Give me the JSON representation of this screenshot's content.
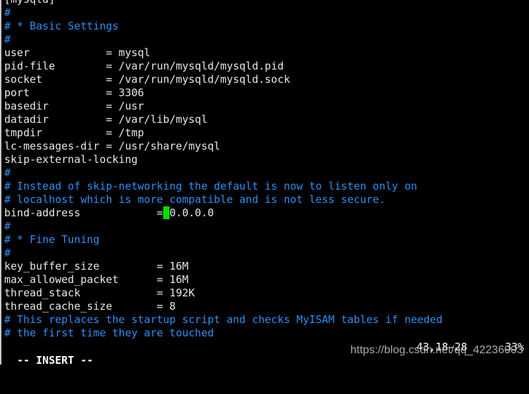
{
  "editor": {
    "lines": [
      {
        "text": "[mysqld]",
        "type": "code"
      },
      {
        "text": "#",
        "type": "comment"
      },
      {
        "text": "# * Basic Settings",
        "type": "comment"
      },
      {
        "text": "#",
        "type": "comment"
      },
      {
        "text": "user            = mysql",
        "type": "code"
      },
      {
        "text": "pid-file        = /var/run/mysqld/mysqld.pid",
        "type": "code"
      },
      {
        "text": "socket          = /var/run/mysqld/mysqld.sock",
        "type": "code"
      },
      {
        "text": "port            = 3306",
        "type": "code"
      },
      {
        "text": "basedir         = /usr",
        "type": "code"
      },
      {
        "text": "datadir         = /var/lib/mysql",
        "type": "code"
      },
      {
        "text": "tmpdir          = /tmp",
        "type": "code"
      },
      {
        "text": "lc-messages-dir = /usr/share/mysql",
        "type": "code"
      },
      {
        "text": "skip-external-locking",
        "type": "code"
      },
      {
        "text": "#",
        "type": "comment"
      },
      {
        "text": "# Instead of skip-networking the default is now to listen only on",
        "type": "comment"
      },
      {
        "text": "# localhost which is more compatible and is not less secure.",
        "type": "comment"
      },
      {
        "text": "bind-address            = 0.0.0.0",
        "type": "code",
        "cursor_col": 25
      },
      {
        "text": "#",
        "type": "comment"
      },
      {
        "text": "# * Fine Tuning",
        "type": "comment"
      },
      {
        "text": "#",
        "type": "comment"
      },
      {
        "text": "key_buffer_size         = 16M",
        "type": "code"
      },
      {
        "text": "max_allowed_packet      = 16M",
        "type": "code"
      },
      {
        "text": "thread_stack            = 192K",
        "type": "code"
      },
      {
        "text": "thread_cache_size       = 8",
        "type": "code"
      },
      {
        "text": "# This replaces the startup script and checks MyISAM tables if needed",
        "type": "comment"
      },
      {
        "text": "# the first time they are touched",
        "type": "comment"
      }
    ]
  },
  "status": {
    "mode": "-- INSERT --",
    "position": "43,18-28",
    "percent": "33%"
  },
  "watermark": "https://blog.csdn.net/qq_42236003",
  "colors": {
    "comment": "#2b8ff0",
    "text": "#e6e6e6",
    "cursor": "#00e000",
    "background": "#000000"
  }
}
